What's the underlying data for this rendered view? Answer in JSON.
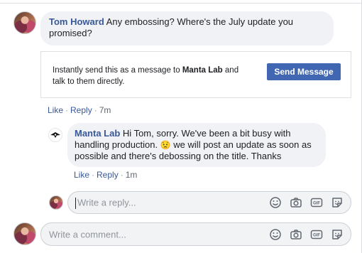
{
  "comment1": {
    "author": "Tom Howard",
    "text_line1": "Any embossing? Where's the July update you",
    "text_line2": "promised?",
    "actions": {
      "like": "Like",
      "reply": "Reply",
      "time": "7m"
    }
  },
  "promo": {
    "text_before": "Instantly send this as a message to ",
    "page_name": "Manta Lab",
    "text_after_line1": " and",
    "text_line2": "talk to them directly.",
    "button": "Send Message"
  },
  "reply1": {
    "author": "Manta Lab",
    "line1": "Hi Tom, sorry. We've been a bit busy with",
    "line2_before": "handling production.",
    "emoji": "😟",
    "line2_after": "we will post an update as soon as",
    "line3": "possible and there's debossing on the title. Thanks",
    "actions": {
      "like": "Like",
      "reply": "Reply",
      "time": "1m"
    }
  },
  "reply_box": {
    "placeholder": "Write a reply...",
    "icons": [
      "emoji-icon",
      "camera-icon",
      "gif-icon",
      "sticker-icon"
    ]
  },
  "comment_box": {
    "placeholder": "Write a comment...",
    "icons": [
      "emoji-icon",
      "camera-icon",
      "gif-icon",
      "sticker-icon"
    ]
  },
  "colors": {
    "link": "#385898",
    "button": "#4267b2",
    "bubble": "#f0f2f5"
  }
}
